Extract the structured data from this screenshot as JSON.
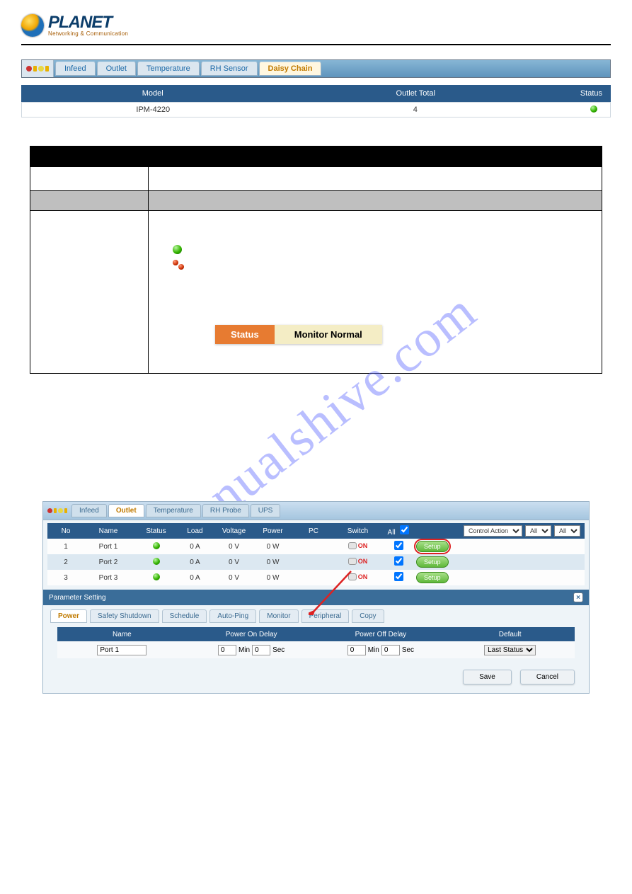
{
  "logo": {
    "brand": "PLANET",
    "subtitle": "Networking & Communication"
  },
  "watermark": "manualshive.com",
  "shot1": {
    "tabs": {
      "infeed": "Infeed",
      "outlet": "Outlet",
      "temperature": "Temperature",
      "rh_sensor": "RH Sensor",
      "daisy_chain": "Daisy Chain"
    },
    "table_header": {
      "model": "Model",
      "outlet_total": "Outlet Total",
      "status": "Status"
    },
    "row": {
      "model": "IPM-4220",
      "outlet_total": "4"
    }
  },
  "status_pill": {
    "left": "Status",
    "right": "Monitor Normal"
  },
  "shot2": {
    "tabs": {
      "infeed": "Infeed",
      "outlet": "Outlet",
      "temperature": "Temperature",
      "rh_probe": "RH Probe",
      "ups": "UPS"
    },
    "header": {
      "no": "No",
      "name": "Name",
      "status": "Status",
      "load": "Load",
      "voltage": "Voltage",
      "power": "Power",
      "pc": "PC",
      "switch": "Switch",
      "all": "All"
    },
    "action_selects": {
      "control_action": "Control Action",
      "all1": "All",
      "all2": "All"
    },
    "setup_label": "Setup",
    "on_label": "ON",
    "rows": [
      {
        "no": "1",
        "name": "Port 1",
        "load": "0 A",
        "voltage": "0 V",
        "power": "0 W"
      },
      {
        "no": "2",
        "name": "Port 2",
        "load": "0 A",
        "voltage": "0 V",
        "power": "0 W"
      },
      {
        "no": "3",
        "name": "Port 3",
        "load": "0 A",
        "voltage": "0 V",
        "power": "0 W"
      }
    ],
    "param_panel": {
      "title": "Parameter Setting",
      "tabs": {
        "power": "Power",
        "safety": "Safety Shutdown",
        "schedule": "Schedule",
        "autoping": "Auto-Ping",
        "monitor": "Monitor",
        "peripheral": "Peripheral",
        "copy": "Copy"
      },
      "cols": {
        "name": "Name",
        "pon": "Power On Delay",
        "poff": "Power Off Delay",
        "default": "Default"
      },
      "values": {
        "name": "Port 1",
        "pon_min": "0",
        "pon_sec": "0",
        "min_label": "Min",
        "sec_label": "Sec",
        "poff_min": "0",
        "poff_sec": "0",
        "default": "Last Status"
      },
      "buttons": {
        "save": "Save",
        "cancel": "Cancel"
      }
    }
  }
}
